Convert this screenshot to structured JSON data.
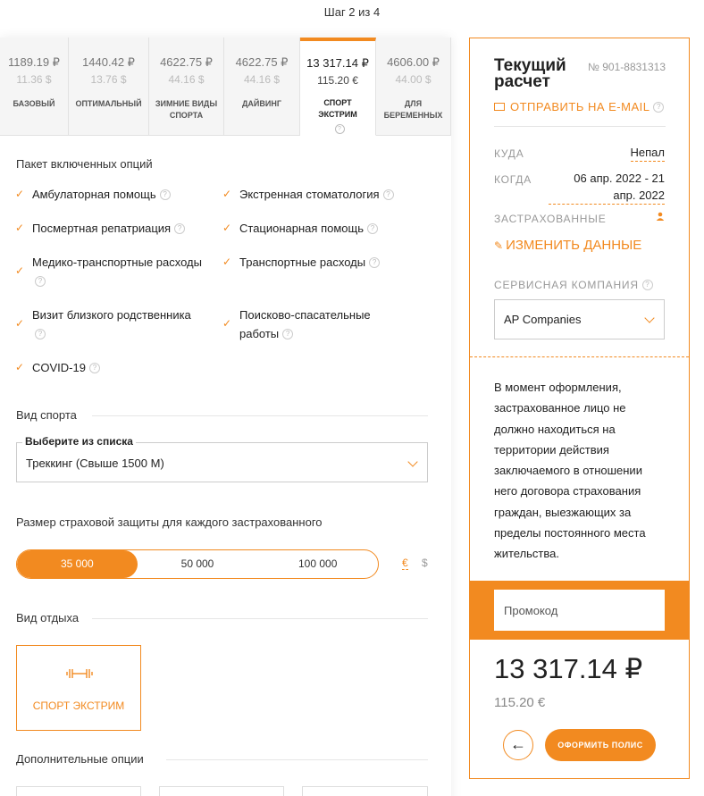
{
  "step_label": "Шаг 2 из 4",
  "colors": {
    "accent": "#f28a20"
  },
  "tabs": [
    {
      "price_rub": "1189.19 ₽",
      "price_usd": "11.36 $",
      "name": "БАЗОВЫЙ"
    },
    {
      "price_rub": "1440.42 ₽",
      "price_usd": "13.76 $",
      "name": "ОПТИМАЛЬНЫЙ"
    },
    {
      "price_rub": "4622.75 ₽",
      "price_usd": "44.16 $",
      "name": "ЗИМНИЕ ВИДЫ СПОРТА"
    },
    {
      "price_rub": "4622.75 ₽",
      "price_usd": "44.16 $",
      "name": "ДАЙВИНГ"
    },
    {
      "price_rub": "13 317.14 ₽",
      "price_usd": "115.20 €",
      "name": "СПОРТ ЭКСТРИМ",
      "active": true
    },
    {
      "price_rub": "4606.00 ₽",
      "price_usd": "44.00 $",
      "name": "ДЛЯ БЕРЕМЕННЫХ"
    }
  ],
  "options": {
    "title": "Пакет включенных опций",
    "items": [
      "Амбулаторная помощь",
      "Экстренная стоматология",
      "Посмертная репатриация",
      "Стационарная помощь",
      "Медико-транспортные расходы",
      "Транспортные расходы",
      "Визит близкого родственника",
      "Поисково-спасательные работы",
      "COVID-19"
    ]
  },
  "sport": {
    "title": "Вид спорта",
    "select_label": "Выберите из списка",
    "select_value": "Треккинг (Свыше 1500 М)"
  },
  "coverage": {
    "title": "Размер страховой защиты для каждого застрахованного",
    "amounts": [
      "35 000",
      "50 000",
      "100 000"
    ],
    "selected_index": 0,
    "currencies": [
      "€",
      "$"
    ],
    "selected_currency": "€"
  },
  "rest": {
    "title": "Вид отдыха",
    "card_label": "СПОРТ ЭКСТРИМ",
    "card_icon": "dumbbell-icon"
  },
  "additional": {
    "title": "Дополнительные опции"
  },
  "summary": {
    "title": "Текущий расчет",
    "number": "№ 901-8831313",
    "email_link": "ОТПРАВИТЬ НА E-MAIL",
    "where_label": "КУДА",
    "where_value": "Непал",
    "when_label": "КОГДА",
    "when_value": "06 апр. 2022 - 21 апр. 2022",
    "insured_label": "ЗАСТРАХОВАННЫЕ",
    "change_link": "ИЗМЕНИТЬ ДАННЫЕ",
    "service_label": "СЕРВИСНАЯ КОМПАНИЯ",
    "service_value": "AP Companies",
    "note": "В момент оформления, застрахованное лицо не должно находиться на территории действия заключаемого в отношении него договора страхования граждан, выезжающих за пределы постоянного места жительства.",
    "promo_placeholder": "Промокод",
    "total_rub": "13 317.14 ₽",
    "total_eur": "115.20 €",
    "back_symbol": "←",
    "order_button": "ОФОРМИТЬ ПОЛИС"
  }
}
